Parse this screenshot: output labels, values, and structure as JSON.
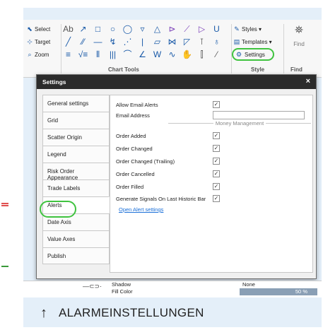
{
  "ribbon": {
    "left_items": [
      {
        "icon": "select-icon",
        "glyph": "⬉",
        "label": "Select"
      },
      {
        "icon": "target-icon",
        "glyph": "⊹",
        "label": "Target"
      },
      {
        "icon": "zoom-icon",
        "glyph": "⌕",
        "label": "Zoom"
      }
    ],
    "tool_rows": [
      [
        "Ab",
        "↗",
        "□",
        "○",
        "◯",
        "▿",
        "△",
        "⊳",
        "⟋",
        "▷",
        "U"
      ],
      [
        "╱",
        "⁄⁄",
        "—",
        "↯",
        "⋰",
        "|",
        "▱",
        "⋈",
        "◸",
        "⊺",
        "♁"
      ],
      [
        "≡",
        "√≡",
        "⫴",
        "|||",
        "⌒",
        "∠",
        "W",
        "∿",
        "✋",
        "⫿",
        "⁄"
      ]
    ],
    "chart_tools_caption": "Chart Tools",
    "style_items": [
      "Styles ▾",
      "Templates ▾",
      "Settings"
    ],
    "style_caption": "Style",
    "find_label": "Find",
    "find_caption": "Find"
  },
  "dialog": {
    "title": "Settings",
    "close": "×",
    "nav": [
      "General settings",
      "Grid",
      "Scatter Origin",
      "Legend",
      "Risk Order Appearance",
      "Trade Labels",
      "Alerts",
      "Date Axis",
      "Value Axes",
      "Publish"
    ],
    "active_nav": "Alerts",
    "content": {
      "allow_email_alerts": {
        "label": "Allow Email Alerts",
        "checked": "✓"
      },
      "email_address": {
        "label": "Email Address",
        "value": ""
      },
      "money_management_header": "Money Management",
      "checks": [
        {
          "label": "Order Added",
          "checked": "✓"
        },
        {
          "label": "Order Changed",
          "checked": "✓"
        },
        {
          "label": "Order Changed (Trailing)",
          "checked": "✓"
        },
        {
          "label": "Order Cancelled",
          "checked": "✓"
        },
        {
          "label": "Order Filled",
          "checked": "✓"
        },
        {
          "label": "Generate Signals On Last Historic Bar",
          "checked": "✓"
        }
      ],
      "open_alert_settings": "Open Alert settings"
    }
  },
  "background": {
    "shadow_label": "Shadow",
    "fill_color_label": "Fill Color",
    "none_value": "None",
    "percent_value": "50 %",
    "handle_glyph": "—⊂⊃·"
  },
  "footer": {
    "arrow": "↑",
    "title": "ALARMEINSTELLUNGEN"
  },
  "colors": {
    "accent_green": "#3fc33f",
    "dialog_title_bg": "#2b2b2b",
    "link_blue": "#1a6fd8",
    "footer_bg": "#e4eff9"
  }
}
